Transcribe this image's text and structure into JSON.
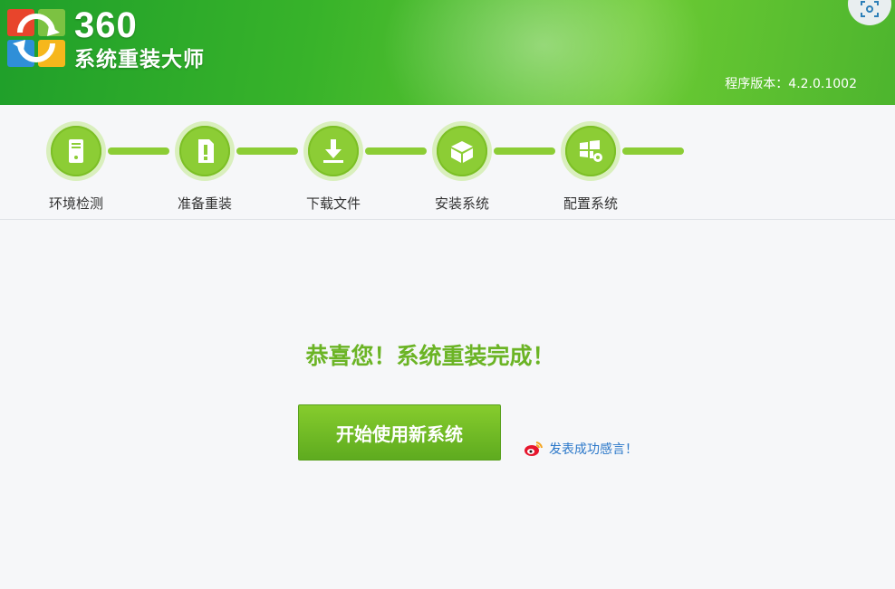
{
  "app": {
    "brand_number": "360",
    "brand_name": "系统重装大师",
    "version_text": "程序版本：4.2.0.1002"
  },
  "colors": {
    "header_green": "#38b32a",
    "step_green": "#8ccd35",
    "message_green": "#6bb425",
    "button_green": "#6fbd25",
    "link_blue": "#2a77c9"
  },
  "steps": [
    {
      "label": "环境检测",
      "icon": "computer-tower-icon"
    },
    {
      "label": "准备重装",
      "icon": "document-alert-icon"
    },
    {
      "label": "下载文件",
      "icon": "download-icon"
    },
    {
      "label": "安装系统",
      "icon": "package-icon"
    },
    {
      "label": "配置系统",
      "icon": "windows-settings-icon"
    }
  ],
  "main": {
    "success_message": "恭喜您！系统重装完成！",
    "start_button_label": "开始使用新系统",
    "share_link_label": "发表成功感言！",
    "share_icon": "weibo-icon"
  }
}
